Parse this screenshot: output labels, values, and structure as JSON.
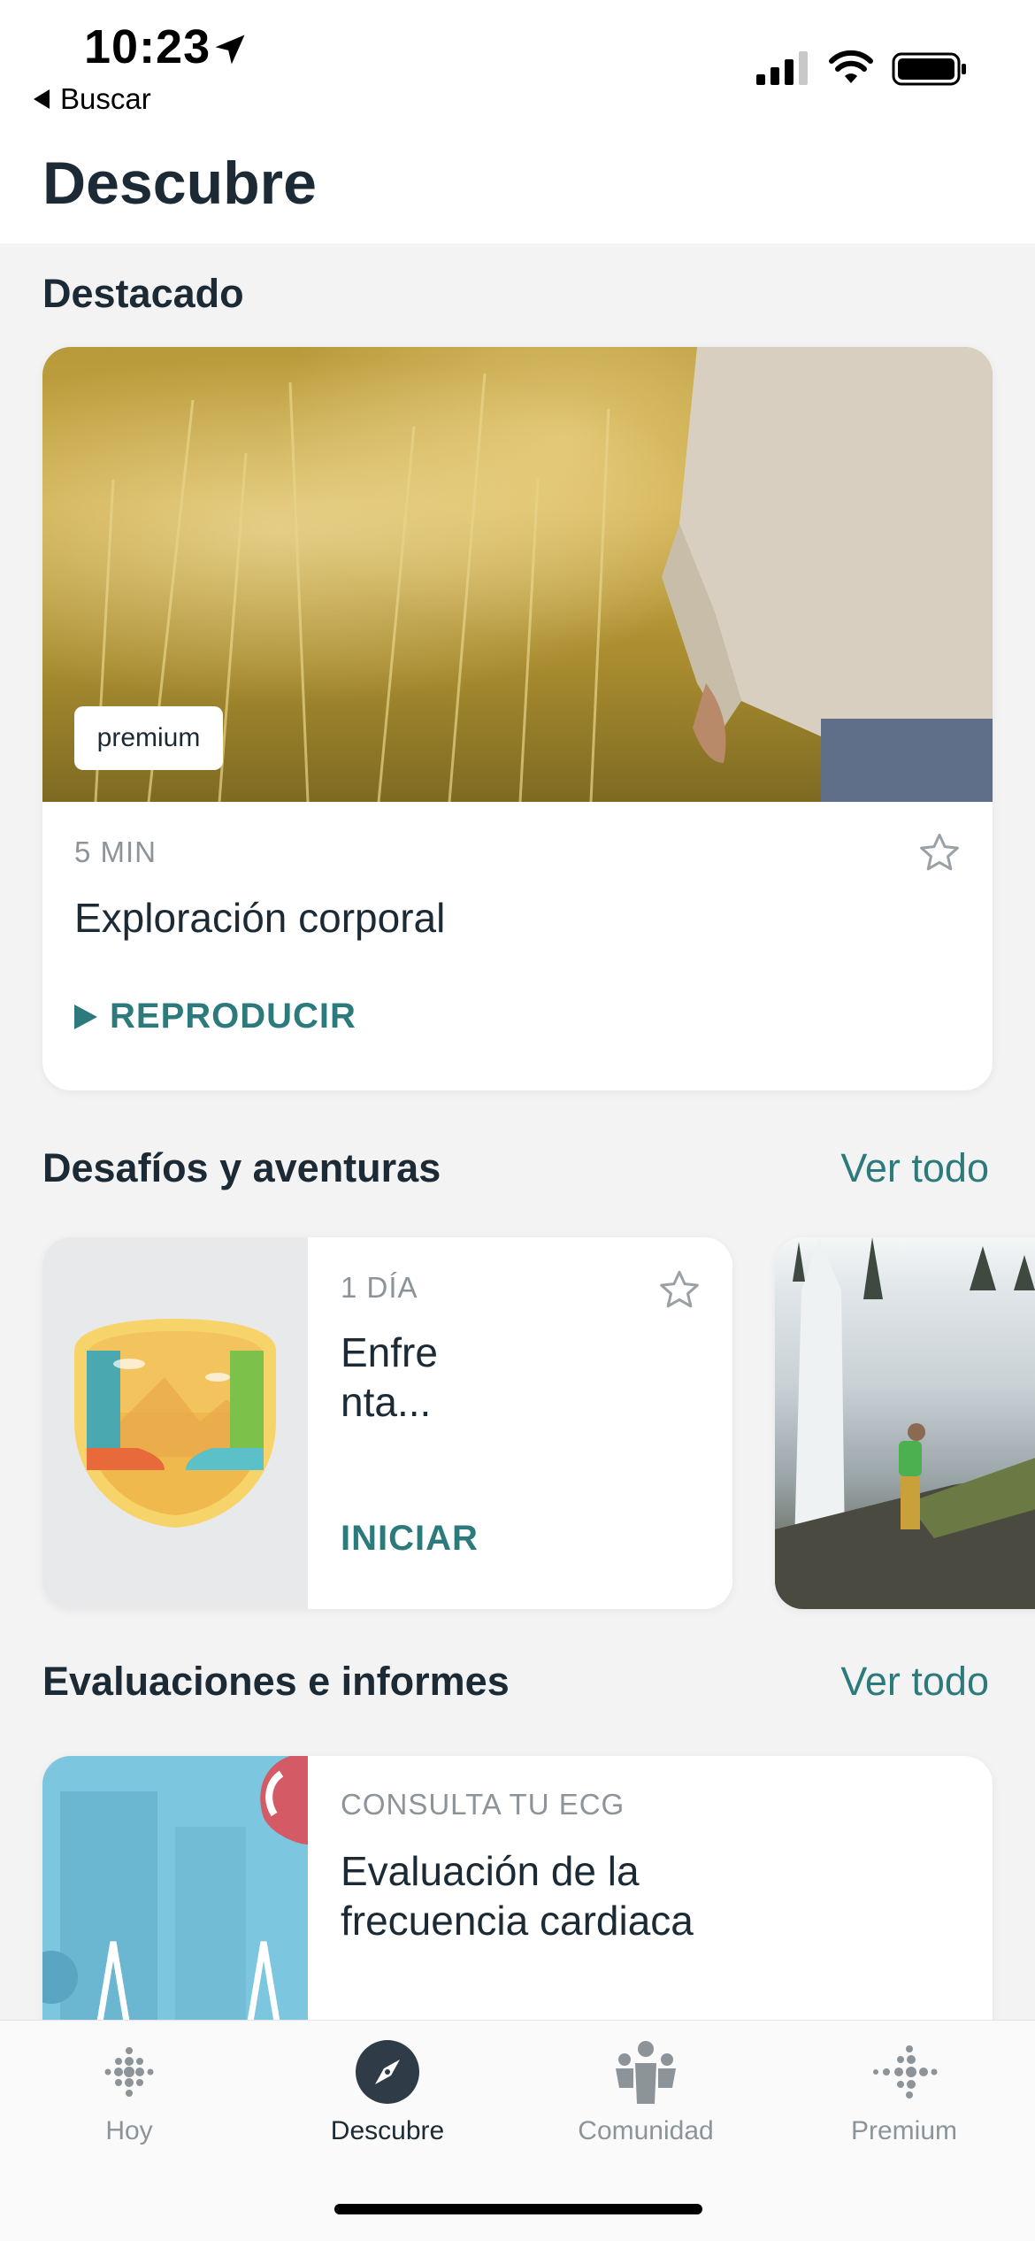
{
  "status_bar": {
    "time": "10:23",
    "back_label": "Buscar"
  },
  "header": {
    "title": "Descubre"
  },
  "featured": {
    "section_title": "Destacado",
    "badge": "premium",
    "duration": "5 MIN",
    "title": "Exploración corporal",
    "action": "REPRODUCIR"
  },
  "challenges": {
    "section_title": "Desafíos y aventuras",
    "see_all": "Ver todo",
    "card": {
      "duration": "1 DÍA",
      "title_line1": "Enfre",
      "title_line2": "nta...",
      "action": "INICIAR"
    }
  },
  "assessments": {
    "section_title": "Evaluaciones e informes",
    "see_all": "Ver todo",
    "card": {
      "category": "CONSULTA TU ECG",
      "title_line1": "Evaluación de la",
      "title_line2": "frecuencia cardiaca"
    }
  },
  "tabbar": {
    "tabs": [
      {
        "label": "Hoy",
        "icon": "fitbit-dots-icon",
        "active": false
      },
      {
        "label": "Descubre",
        "icon": "compass-icon",
        "active": true
      },
      {
        "label": "Comunidad",
        "icon": "community-icon",
        "active": false
      },
      {
        "label": "Premium",
        "icon": "premium-dots-icon",
        "active": false
      }
    ]
  },
  "colors": {
    "accent": "#2c7a7b",
    "text": "#1b2a35",
    "muted": "#8c9499",
    "background": "#f3f3f4"
  }
}
